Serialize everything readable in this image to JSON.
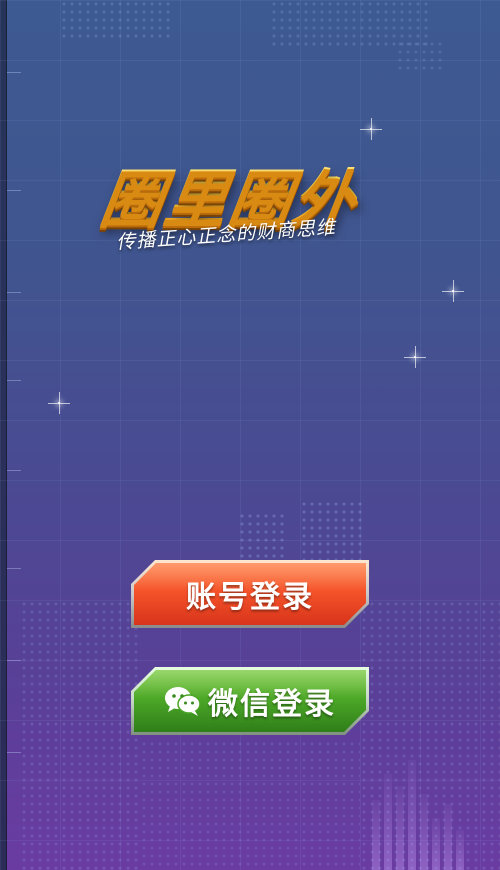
{
  "app": {
    "logo_title": "圈里圈外",
    "logo_subtitle": "传播正心正念的财商思维"
  },
  "buttons": {
    "account_login": "账号登录",
    "wechat_login": "微信登录"
  },
  "icons": {
    "wechat": "wechat-icon"
  },
  "colors": {
    "account_button": "#f5532a",
    "wechat_button": "#4aa526",
    "logo_gold": "#ffd34a",
    "background_top": "#3e5a92",
    "background_bottom": "#6a3ca2"
  }
}
